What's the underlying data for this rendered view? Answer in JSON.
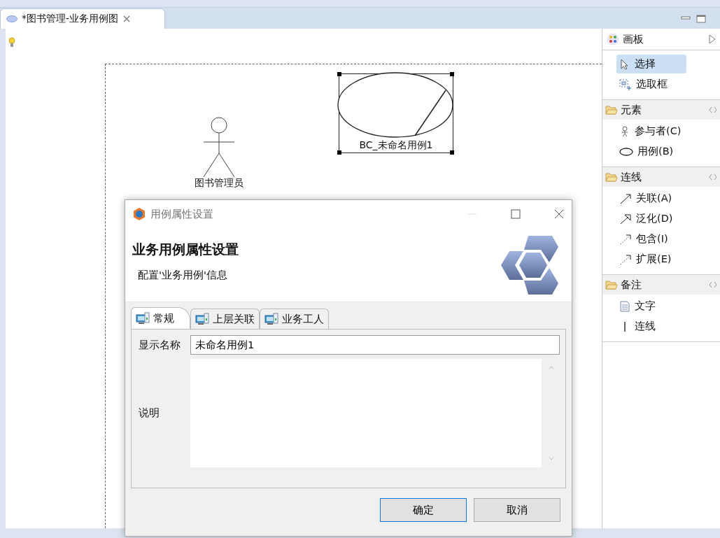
{
  "editor_tab": {
    "title": "*图书管理-业务用例图",
    "selected": true
  },
  "canvas": {
    "actors": [
      {
        "label": "图书管理员"
      }
    ],
    "use_cases": [
      {
        "label": "BC_未命名用例1",
        "selected": true
      }
    ]
  },
  "palette": {
    "title": "画板",
    "tools": [
      {
        "label": "选择",
        "kind": "select",
        "selected": true
      },
      {
        "label": "选取框",
        "kind": "marquee",
        "selected": false
      }
    ],
    "sections": [
      {
        "title": "元素",
        "items": [
          {
            "label": "参与者(C)",
            "kind": "actor"
          },
          {
            "label": "用例(B)",
            "kind": "usecase"
          }
        ]
      },
      {
        "title": "连线",
        "items": [
          {
            "label": "关联(A)",
            "kind": "association"
          },
          {
            "label": "泛化(D)",
            "kind": "generalization"
          },
          {
            "label": "包含(I)",
            "kind": "include"
          },
          {
            "label": "扩展(E)",
            "kind": "extend"
          }
        ]
      },
      {
        "title": "备注",
        "items": [
          {
            "label": "文字",
            "kind": "note"
          },
          {
            "label": "连线",
            "kind": "connection"
          }
        ]
      }
    ]
  },
  "dialog": {
    "window_title": "用例属性设置",
    "heading": "业务用例属性设置",
    "description": "配置'业务用例'信息",
    "tabs": [
      {
        "label": "常规",
        "selected": true
      },
      {
        "label": "上层关联",
        "selected": false
      },
      {
        "label": "业务工人",
        "selected": false
      }
    ],
    "name_label": "显示名称",
    "name_value": "未命名用例1",
    "description_label": "说明",
    "buttons": [
      {
        "label": "确定",
        "default": true
      },
      {
        "label": "取消",
        "default": false
      }
    ]
  }
}
